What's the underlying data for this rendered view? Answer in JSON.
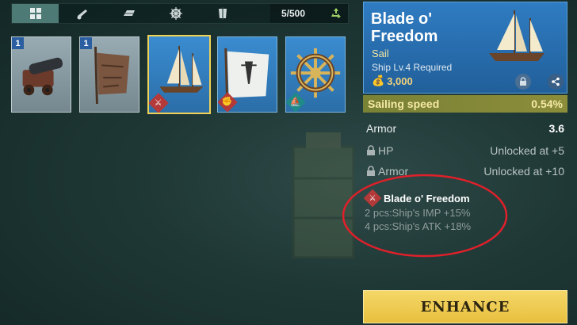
{
  "tabs": [
    {
      "name": "all-tab",
      "icon": "grid-icon",
      "active": true
    },
    {
      "name": "cannon-tab",
      "icon": "cannon-icon",
      "active": false
    },
    {
      "name": "hull-tab",
      "icon": "hull-icon",
      "active": false
    },
    {
      "name": "helm-tab",
      "icon": "helm-icon",
      "active": false
    },
    {
      "name": "sail-tab",
      "icon": "sail-icon",
      "active": false
    }
  ],
  "inventory": {
    "count": "5/500",
    "recycle_icon": "recycle-icon"
  },
  "items": [
    {
      "name": "cannon-item",
      "qty": "1",
      "art": "cannon-icon",
      "badge": null
    },
    {
      "name": "tattered-sail-item",
      "qty": "1",
      "art": "tattered-sail-icon",
      "badge": null
    },
    {
      "name": "blade-sail-item",
      "qty": "",
      "art": "sail-ship-icon",
      "badge": "swords-icon",
      "selected": true
    },
    {
      "name": "white-sail-item",
      "qty": "",
      "art": "white-sail-icon",
      "badge": "fist-icon"
    },
    {
      "name": "helm-item",
      "qty": "",
      "art": "helm-wheel-icon",
      "badge": "sail-badge-icon"
    }
  ],
  "detail": {
    "title": "Blade o' Freedom",
    "type": "Sail",
    "requirement": "Ship Lv.4 Required",
    "price": "3,000",
    "main_stat": {
      "label": "Sailing speed",
      "value": "0.54%"
    },
    "stats": [
      {
        "label": "Armor",
        "value": "3.6"
      }
    ],
    "locked": [
      {
        "label": "HP",
        "value": "Unlocked at +5"
      },
      {
        "label": "Armor",
        "value": "Unlocked at +10"
      }
    ],
    "set": {
      "name": "Blade o' Freedom",
      "bonus_2": "2 pcs:Ship's IMP +15%",
      "bonus_4": "4 pcs:Ship's ATK +18%"
    },
    "enhance_label": "ENHANCE"
  },
  "colors": {
    "accent_gold": "#f0d256",
    "card_blue": "#2f7cc2",
    "annotation_red": "#e0202a"
  }
}
